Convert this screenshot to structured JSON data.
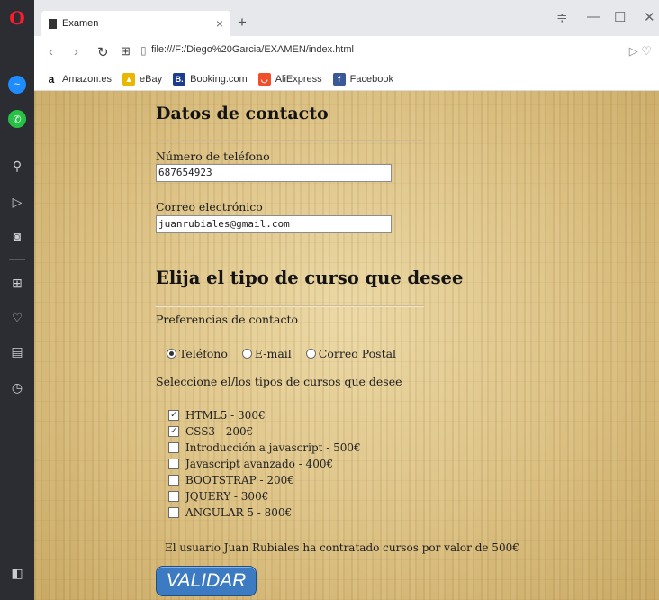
{
  "browser": {
    "tab_title": "Examen",
    "url": "file:///F:/Diego%20Garcia/EXAMEN/index.html",
    "bookmarks": [
      "Amazon.es",
      "eBay",
      "Booking.com",
      "AliExpress",
      "Facebook"
    ]
  },
  "contact": {
    "heading": "Datos de contacto",
    "phone_label": "Número de teléfono",
    "phone_value": "687654923",
    "email_label": "Correo electrónico",
    "email_value": "juanrubiales@gmail.com"
  },
  "course": {
    "heading": "Elija el tipo de curso que desee",
    "pref_label": "Preferencias de contacto",
    "radio_options": [
      "Teléfono",
      "E-mail",
      "Correo Postal"
    ],
    "radio_selected": "Teléfono",
    "select_label": "Seleccione el/los tipos de cursos que desee",
    "courses": [
      {
        "label": "HTML5 - 300€",
        "checked": true
      },
      {
        "label": "CSS3 - 200€",
        "checked": true
      },
      {
        "label": "Introducción a javascript - 500€",
        "checked": false
      },
      {
        "label": "Javascript avanzado - 400€",
        "checked": false
      },
      {
        "label": "BOOTSTRAP - 200€",
        "checked": false
      },
      {
        "label": "JQUERY - 300€",
        "checked": false
      },
      {
        "label": "ANGULAR 5 - 800€",
        "checked": false
      }
    ],
    "summary": "El usuario Juan Rubiales ha contratado cursos por valor de 500€",
    "validate_button": "VALIDAR"
  },
  "colors": {
    "accent_button": "#3c7bc2",
    "opera_red": "#ff1b2d"
  }
}
